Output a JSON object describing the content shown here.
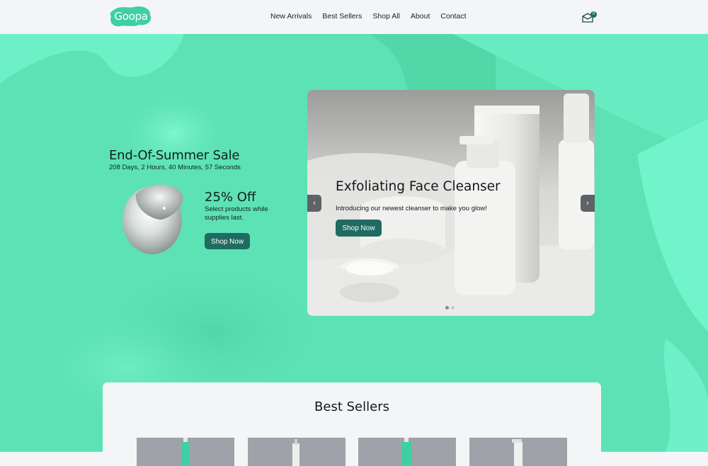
{
  "brand": {
    "logo_text": "Goopa",
    "accent": "#5ee3b6",
    "button_color": "#1f6b62"
  },
  "nav": {
    "items": [
      {
        "label": "New Arrivals"
      },
      {
        "label": "Best Sellers"
      },
      {
        "label": "Shop All"
      },
      {
        "label": "About"
      },
      {
        "label": "Contact"
      }
    ],
    "cart": {
      "icon": "cart-icon",
      "count": "0"
    }
  },
  "promo": {
    "title": "End-Of-Summer Sale",
    "countdown": "208 Days, 2 Hours, 40 Minutes, 57 Seconds",
    "discount": "25% Off",
    "description": "Select products while supplies last.",
    "button": "Shop Now"
  },
  "slider": {
    "title": "Exfoliating Face Cleanser",
    "subtitle": "Introducing our newest cleanser to make you glow!",
    "button": "Shop Now",
    "prev_icon": "chevron-left-icon",
    "next_icon": "chevron-right-icon",
    "slide_count": 2,
    "active_slide": 1
  },
  "best_sellers": {
    "title": "Best Sellers"
  }
}
